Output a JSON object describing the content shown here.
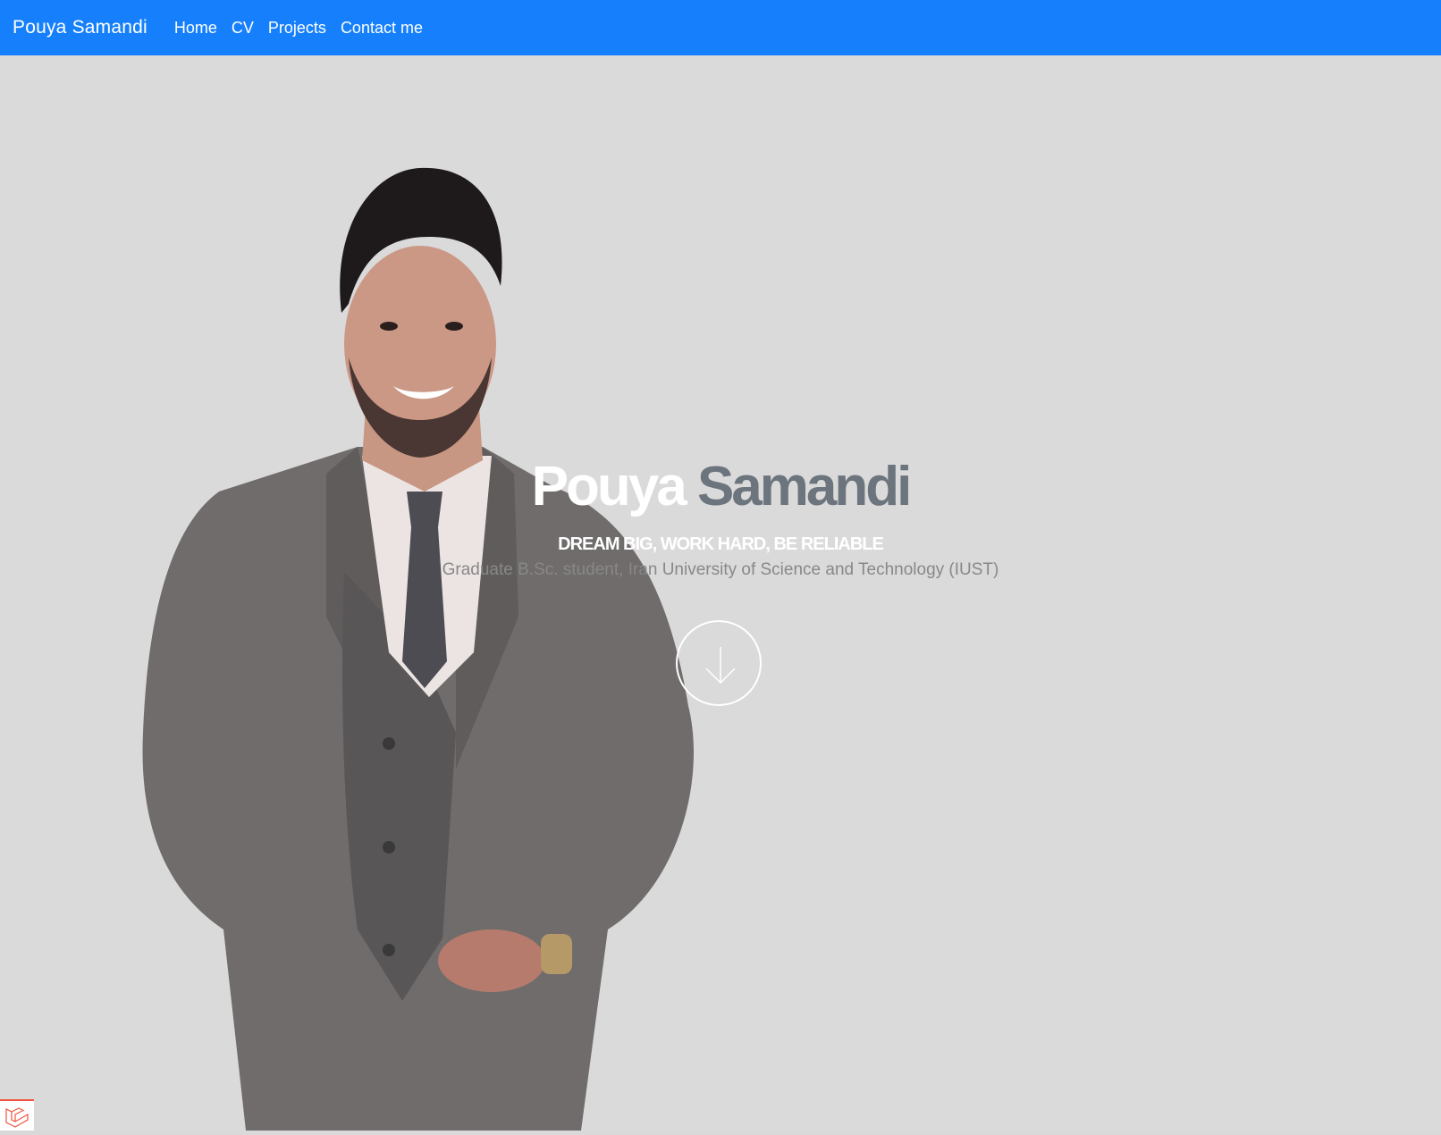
{
  "navbar": {
    "brand": "Pouya Samandi",
    "links": [
      {
        "label": "Home"
      },
      {
        "label": "CV"
      },
      {
        "label": "Projects"
      },
      {
        "label": "Contact me"
      }
    ],
    "background_color": "#1680fc"
  },
  "hero": {
    "first_name": "Pouya",
    "last_name": "Samandi",
    "motto": "DREAM BIG, WORK HARD, BE RELIABLE",
    "subtitle": "Graduate B.Sc. student, Iran University of Science and Technology (IUST)",
    "scroll_icon": "arrow-down-icon",
    "background_color": "#dadada"
  },
  "debug_badge": {
    "icon": "laravel-logo-icon",
    "accent_color": "#f05340"
  }
}
